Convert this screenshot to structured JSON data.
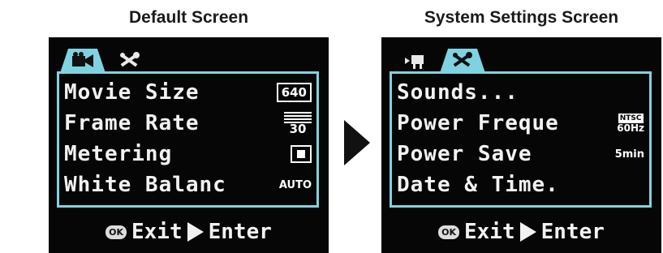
{
  "captions": {
    "left": "Default Screen",
    "right": "System Settings Screen"
  },
  "colors": {
    "accent": "#7fd3e0",
    "screen_bg": "#060606",
    "text": "#f2f2f2"
  },
  "default_screen": {
    "tabs": [
      {
        "icon": "movie-camera-icon",
        "active": true
      },
      {
        "icon": "tools-icon",
        "active": false
      }
    ],
    "rows": [
      {
        "label": "Movie Size",
        "value": "640",
        "icon": "resolution-icon"
      },
      {
        "label": "Frame Rate",
        "value": "30",
        "icon": "frame-rate-icon"
      },
      {
        "label": "Metering",
        "value": "",
        "icon": "spot-metering-icon"
      },
      {
        "label": "White Balanc",
        "value": "AUTO",
        "icon": "white-balance-icon"
      }
    ],
    "footer": {
      "ok": "OK",
      "exit": "Exit",
      "enter": "Enter"
    }
  },
  "system_settings_screen": {
    "tabs": [
      {
        "icon": "movie-camera-icon",
        "active": false
      },
      {
        "icon": "tools-icon",
        "active": true
      }
    ],
    "rows": [
      {
        "label": "Sounds...",
        "value": ""
      },
      {
        "label": "Power Freque",
        "value": "60Hz",
        "value_top": "NTSC",
        "icon": "power-frequency-icon"
      },
      {
        "label": "Power Save",
        "value": "5min"
      },
      {
        "label": "Date & Time.",
        "value": ""
      }
    ],
    "footer": {
      "ok": "OK",
      "exit": "Exit",
      "enter": "Enter"
    }
  }
}
